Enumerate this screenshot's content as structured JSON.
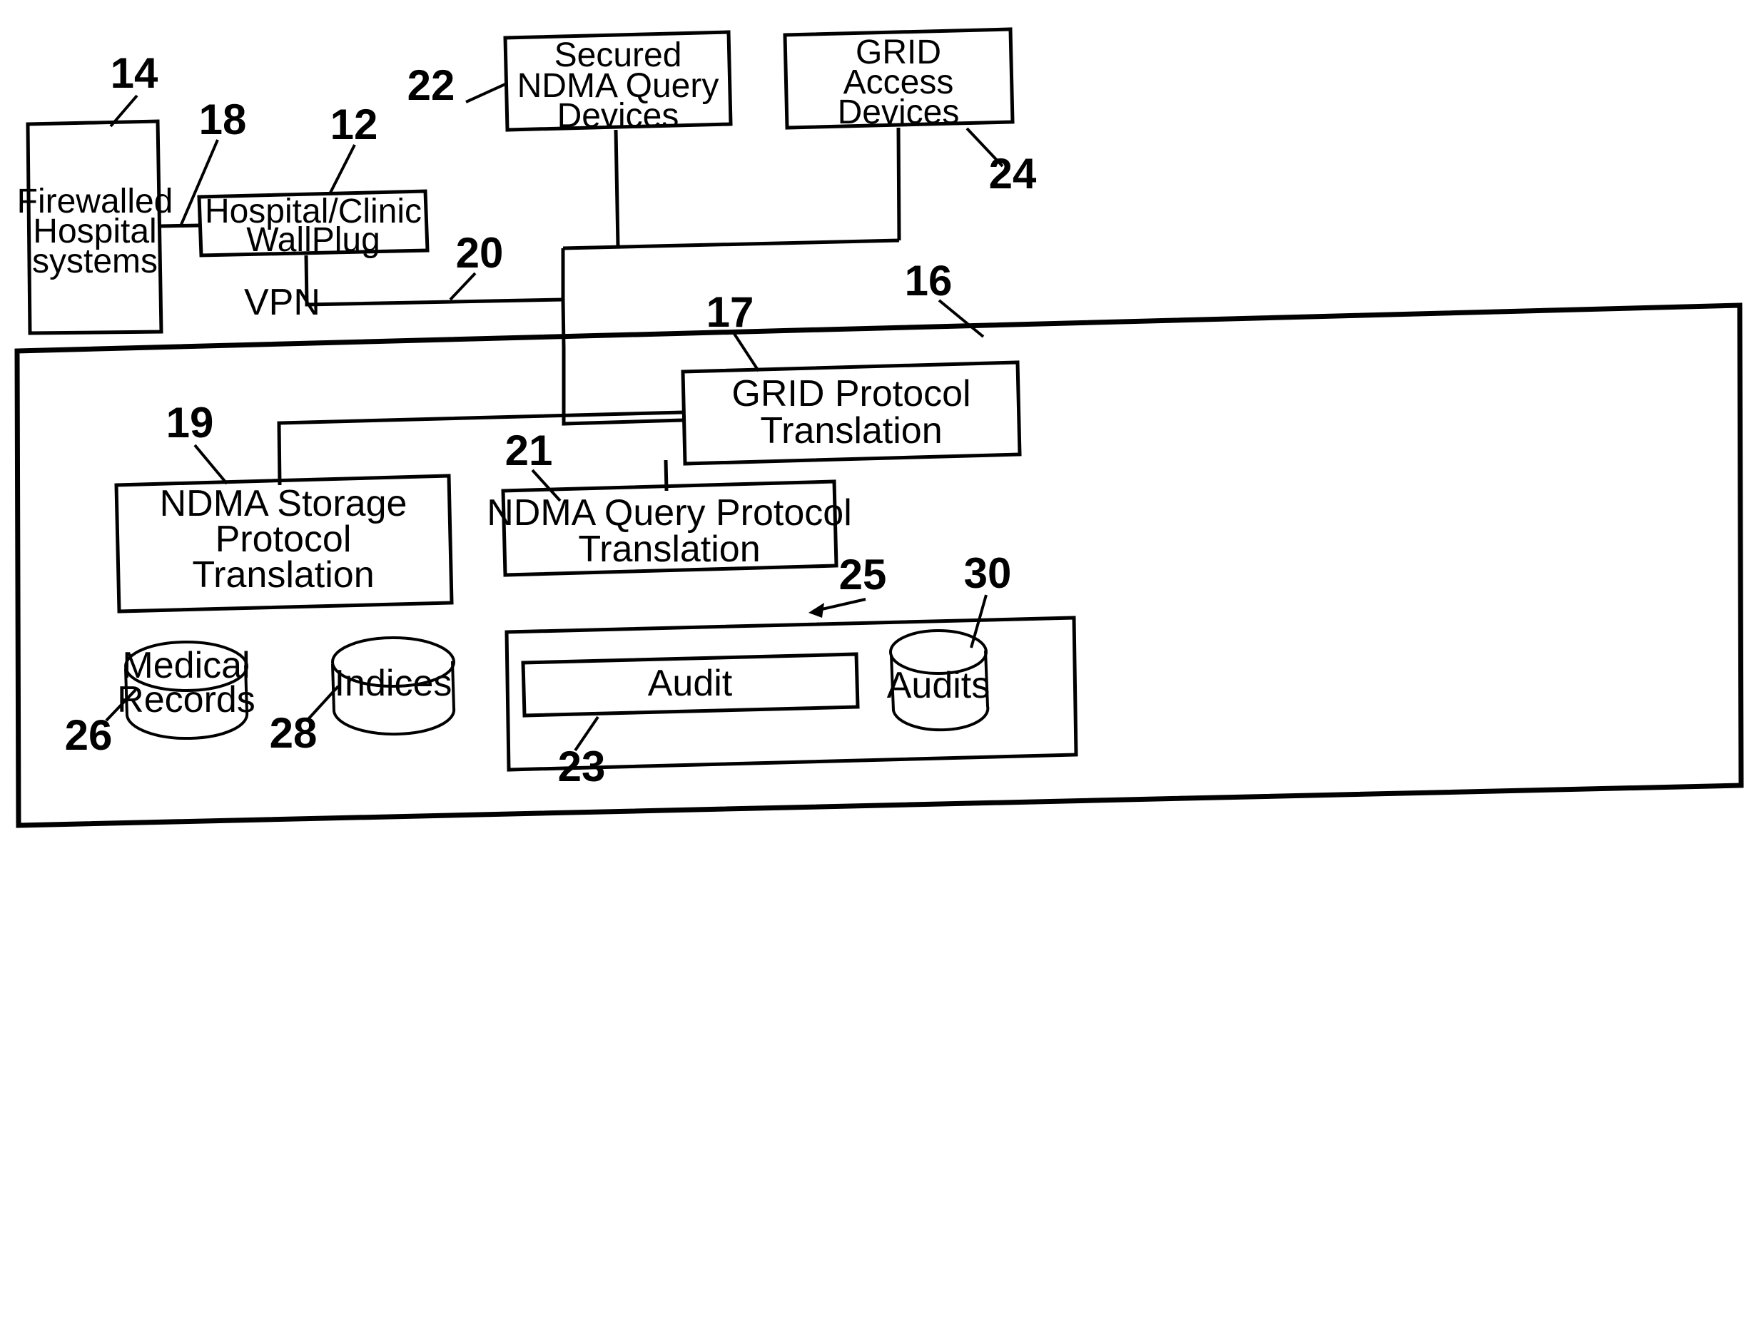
{
  "figure": {
    "type": "patent-block-diagram",
    "description": "NDMA medical record storage, query and audit network architecture"
  },
  "nodes": {
    "firewalled_hospital": {
      "lines": [
        "Firewalled",
        "Hospital",
        "systems"
      ],
      "ref": "14"
    },
    "wallplug": {
      "lines": [
        "Hospital/Clinic",
        "WallPlug"
      ],
      "ref": "12"
    },
    "secured_query_devices": {
      "lines": [
        "Secured",
        "NDMA Query",
        "Devices"
      ],
      "ref": "22"
    },
    "grid_access_devices": {
      "lines": [
        "GRID",
        "Access",
        "Devices"
      ],
      "ref": "24"
    },
    "grid_protocol_translation": {
      "lines": [
        "GRID Protocol",
        "Translation"
      ],
      "ref": "17"
    },
    "ndma_storage_protocol_translation": {
      "lines": [
        "NDMA Storage",
        "Protocol",
        "Translation"
      ],
      "ref": "19"
    },
    "ndma_query_protocol_translation": {
      "lines": [
        "NDMA Query Protocol",
        "Translation"
      ],
      "ref": "21"
    },
    "medical_records": {
      "lines": [
        "Medical",
        "Records"
      ],
      "ref": "26"
    },
    "indices": {
      "lines": [
        "Indices"
      ],
      "ref": "28"
    },
    "audit": {
      "lines": [
        "Audit"
      ],
      "ref": "23"
    },
    "audits": {
      "lines": [
        "Audits"
      ],
      "ref": "30"
    },
    "audit_subsystem": {
      "ref": "25"
    },
    "main_container": {
      "ref": "16"
    }
  },
  "connections": {
    "vpn_label": "VPN",
    "vpn_ref": "20",
    "hospital_to_wallplug_ref": "18"
  },
  "reference_numerals": {
    "n12": "12",
    "n14": "14",
    "n16": "16",
    "n17": "17",
    "n18": "18",
    "n19": "19",
    "n20": "20",
    "n21": "21",
    "n22": "22",
    "n23": "23",
    "n24": "24",
    "n25": "25",
    "n26": "26",
    "n28": "28",
    "n30": "30"
  },
  "text": {
    "firewalled_l1": "Firewalled",
    "firewalled_l2": "Hospital",
    "firewalled_l3": "systems",
    "wallplug_l1": "Hospital/Clinic",
    "wallplug_l2": "WallPlug",
    "secured_l1": "Secured",
    "secured_l2": "NDMA Query",
    "secured_l3": "Devices",
    "grid_access_l1": "GRID",
    "grid_access_l2": "Access",
    "grid_access_l3": "Devices",
    "grid_proto_l1": "GRID Protocol",
    "grid_proto_l2": "Translation",
    "storage_l1": "NDMA Storage",
    "storage_l2": "Protocol",
    "storage_l3": "Translation",
    "query_l1": "NDMA Query Protocol",
    "query_l2": "Translation",
    "medical_l1": "Medical",
    "medical_l2": "Records",
    "indices_l1": "Indices",
    "audit_l1": "Audit",
    "audits_l1": "Audits",
    "vpn": "VPN"
  },
  "colors": {
    "stroke": "#000000",
    "background": "#ffffff"
  }
}
